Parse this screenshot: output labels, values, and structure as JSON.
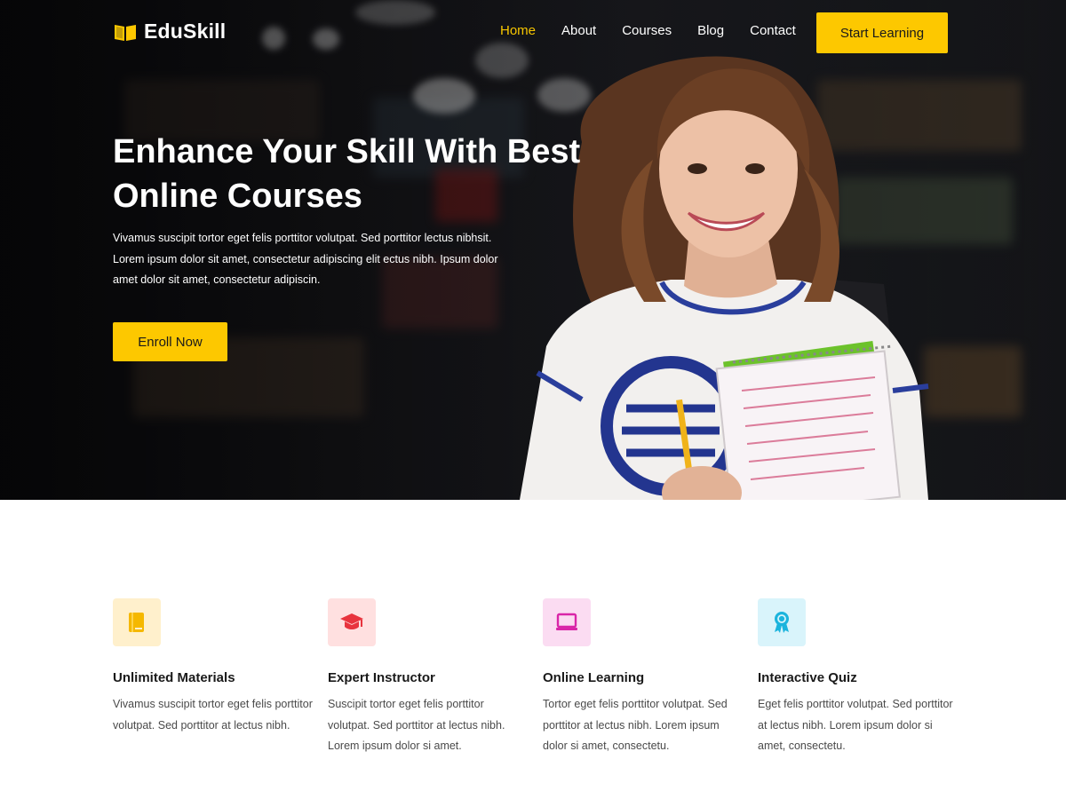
{
  "brand": {
    "name": "EduSkill",
    "accent": "#fdc800"
  },
  "nav": {
    "items": [
      {
        "label": "Home",
        "active": true
      },
      {
        "label": "About",
        "active": false
      },
      {
        "label": "Courses",
        "active": false
      },
      {
        "label": "Blog",
        "active": false
      },
      {
        "label": "Contact",
        "active": false
      }
    ],
    "cta_label": "Start Learning"
  },
  "hero": {
    "title": "Enhance Your Skill With Best Online Courses",
    "description": "Vivamus suscipit tortor eget felis porttitor volutpat. Sed porttitor lectus nibhsit. Lorem ipsum dolor sit amet, consectetur adipiscing elit ectus nibh. Ipsum dolor amet dolor sit amet, consectetur adipiscin.",
    "enroll_label": "Enroll Now"
  },
  "features": [
    {
      "icon": "book-icon",
      "icon_bg": "#fff0cc",
      "icon_color": "#f5b800",
      "title": "Unlimited Materials",
      "description": "Vivamus suscipit tortor eget felis porttitor volutpat. Sed porttitor at lectus nibh."
    },
    {
      "icon": "graduation-cap-icon",
      "icon_bg": "#ffe0e0",
      "icon_color": "#e8343e",
      "title": "Expert Instructor",
      "description": "Suscipit tortor eget felis porttitor volutpat. Sed porttitor at lectus nibh. Lorem ipsum dolor si amet."
    },
    {
      "icon": "laptop-icon",
      "icon_bg": "#fbdcf2",
      "icon_color": "#d926a8",
      "title": "Online Learning",
      "description": "Tortor eget felis porttitor volutpat. Sed porttitor at lectus nibh. Lorem ipsum dolor si amet, consectetu."
    },
    {
      "icon": "award-ribbon-icon",
      "icon_bg": "#d9f4fb",
      "icon_color": "#1bb4dd",
      "title": "Interactive Quiz",
      "description": "Eget felis porttitor volutpat. Sed porttitor at lectus nibh. Lorem ipsum dolor si amet, consectetu."
    }
  ]
}
